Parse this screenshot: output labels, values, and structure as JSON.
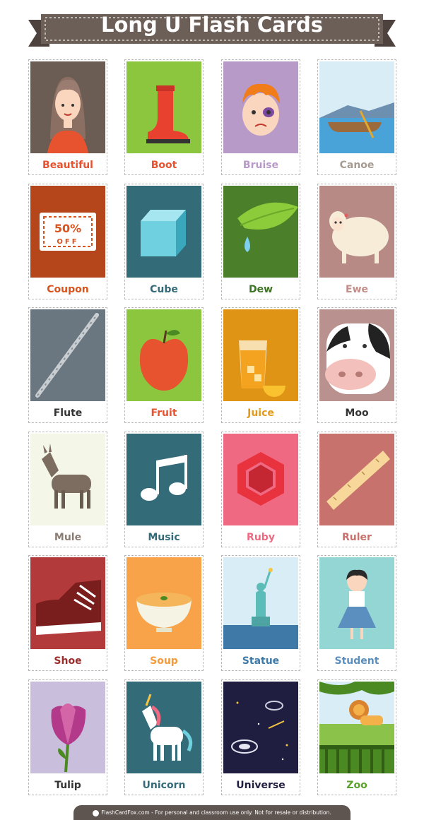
{
  "header": {
    "title": "Long U Flash Cards"
  },
  "colors": {
    "banner": "#6b5f58",
    "banner_dark": "#4d423d"
  },
  "cards": [
    {
      "word": "Beautiful",
      "bg": "#6b5c54",
      "label_color": "#e8532f",
      "icon": "girl-icon"
    },
    {
      "word": "Boot",
      "bg": "#8cc63f",
      "label_color": "#e8532f",
      "icon": "boot-icon"
    },
    {
      "word": "Bruise",
      "bg": "#b89ac8",
      "label_color": "#b89ac8",
      "icon": "bruised-boy-icon"
    },
    {
      "word": "Canoe",
      "bg": "#d8edf5",
      "label_color": "#a79b91",
      "icon": "canoe-icon"
    },
    {
      "word": "Coupon",
      "bg": "#b5451b",
      "label_color": "#d9531e",
      "icon": "coupon-icon"
    },
    {
      "word": "Cube",
      "bg": "#346b78",
      "label_color": "#346b78",
      "icon": "cube-icon"
    },
    {
      "word": "Dew",
      "bg": "#4b7f2a",
      "label_color": "#3f7426",
      "icon": "dew-leaf-icon"
    },
    {
      "word": "Ewe",
      "bg": "#b88a86",
      "label_color": "#c28e89",
      "icon": "sheep-icon"
    },
    {
      "word": "Flute",
      "bg": "#6a7780",
      "label_color": "#333333",
      "icon": "flute-icon"
    },
    {
      "word": "Fruit",
      "bg": "#8cc63f",
      "label_color": "#e8532f",
      "icon": "apple-icon"
    },
    {
      "word": "Juice",
      "bg": "#df9416",
      "label_color": "#e39a1b",
      "icon": "juice-icon"
    },
    {
      "word": "Moo",
      "bg": "#b99290",
      "label_color": "#333333",
      "icon": "cow-icon"
    },
    {
      "word": "Mule",
      "bg": "#f4f6e8",
      "label_color": "#8c7d74",
      "icon": "mule-icon"
    },
    {
      "word": "Music",
      "bg": "#346b78",
      "label_color": "#346b78",
      "icon": "music-note-icon"
    },
    {
      "word": "Ruby",
      "bg": "#f06982",
      "label_color": "#f06982",
      "icon": "ruby-icon"
    },
    {
      "word": "Ruler",
      "bg": "#c8726d",
      "label_color": "#c8726d",
      "icon": "ruler-icon"
    },
    {
      "word": "Shoe",
      "bg": "#b23a3a",
      "label_color": "#9b2c2c",
      "icon": "sneaker-icon"
    },
    {
      "word": "Soup",
      "bg": "#f8a34a",
      "label_color": "#f29a3c",
      "icon": "soup-icon"
    },
    {
      "word": "Statue",
      "bg": "#d8edf5",
      "label_color": "#3e79a8",
      "icon": "statue-of-liberty-icon"
    },
    {
      "word": "Student",
      "bg": "#93d6d4",
      "label_color": "#5a8fbf",
      "icon": "student-icon"
    },
    {
      "word": "Tulip",
      "bg": "#c9bfdc",
      "label_color": "#333333",
      "icon": "tulip-icon"
    },
    {
      "word": "Unicorn",
      "bg": "#346b78",
      "label_color": "#346b78",
      "icon": "unicorn-icon"
    },
    {
      "word": "Universe",
      "bg": "#1f1e40",
      "label_color": "#1f1e40",
      "icon": "galaxy-icon"
    },
    {
      "word": "Zoo",
      "bg": "#d8edf5",
      "label_color": "#5aa22a",
      "icon": "zoo-lion-icon"
    }
  ],
  "footer": {
    "text": "FlashCardFox.com - For personal and classroom use only. Not for resale or distribution."
  }
}
